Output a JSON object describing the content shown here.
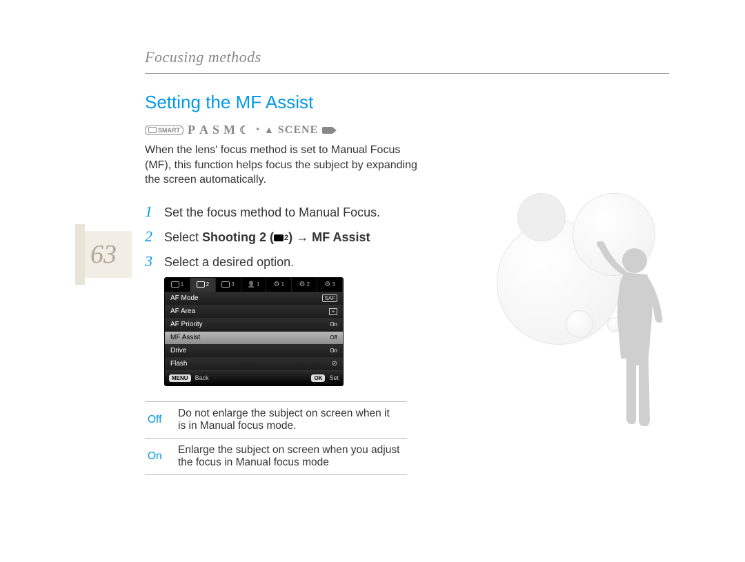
{
  "header": {
    "breadcrumb": "Focusing methods"
  },
  "page_number": "63",
  "section": {
    "title": "Setting the MF Assist"
  },
  "mode_row": {
    "smart_label": "SMART",
    "letters": [
      "P",
      "A",
      "S",
      "M"
    ],
    "scene_label": "SCENE"
  },
  "intro": "When the lens' focus method is set to Manual Focus (MF), this function helps focus the subject by expanding the screen automatically.",
  "steps": [
    {
      "n": "1",
      "text": "Set the focus method to Manual Focus."
    },
    {
      "n": "2",
      "prefix": "Select ",
      "bold1": "Shooting 2 (",
      "cam_sub": "2",
      "bold2": ")",
      "arrow": " → ",
      "bold3": "MF Assist"
    },
    {
      "n": "3",
      "text": "Select a desired option."
    }
  ],
  "menu": {
    "tabs": [
      {
        "kind": "cam",
        "n": "1"
      },
      {
        "kind": "cam",
        "n": "2",
        "active": true
      },
      {
        "kind": "cam",
        "n": "3"
      },
      {
        "kind": "person",
        "n": "1"
      },
      {
        "kind": "gear",
        "n": "1"
      },
      {
        "kind": "gear",
        "n": "2"
      },
      {
        "kind": "gear",
        "n": "3"
      }
    ],
    "rows": [
      {
        "label": "AF Mode",
        "value_kind": "saf",
        "value": "SAF"
      },
      {
        "label": "AF Area",
        "value_kind": "plus",
        "value": "+"
      },
      {
        "label": "AF Priority",
        "value_kind": "text",
        "value": "On"
      },
      {
        "label": "MF Assist",
        "value_kind": "text",
        "value": "Off",
        "selected": true
      },
      {
        "label": "Drive",
        "value_kind": "text",
        "value": "On"
      },
      {
        "label": "Flash",
        "value_kind": "flash",
        "value": ""
      }
    ],
    "footer": {
      "menu_pill": "MENU",
      "back": "Back",
      "ok_pill": "OK",
      "set": "Set"
    }
  },
  "options_table": [
    {
      "name": "Off",
      "desc": "Do not enlarge the subject on screen when it is in Manual focus mode."
    },
    {
      "name": "On",
      "desc": "Enlarge the subject on screen when you adjust the focus in Manual focus mode"
    }
  ]
}
